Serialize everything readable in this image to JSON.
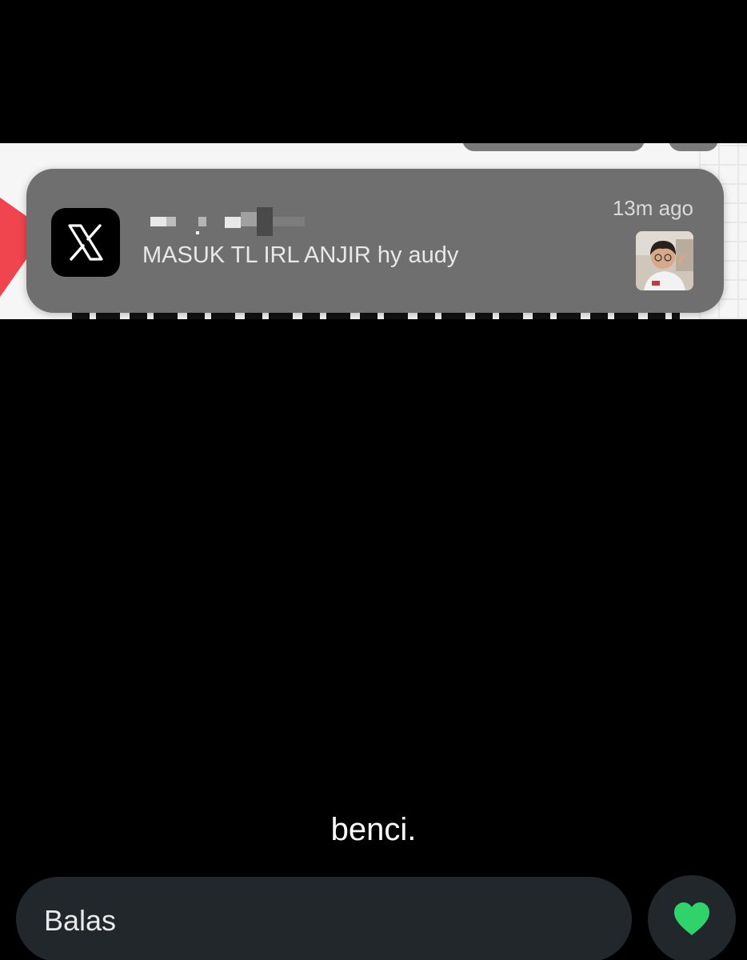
{
  "notification": {
    "app_icon": "x-logo-icon",
    "message": "MASUK TL IRL ANJIR hy audy",
    "time": "13m ago",
    "thumbnail": "profile-photo"
  },
  "story": {
    "caption": "benci."
  },
  "reply": {
    "placeholder": "Balas",
    "like_icon": "heart-icon",
    "like_color": "#2fd36a"
  },
  "colors": {
    "background": "#000000",
    "notification_bg": "#6f6f6f",
    "reply_bg": "#22272b",
    "embed_accent": "#f0444f"
  }
}
